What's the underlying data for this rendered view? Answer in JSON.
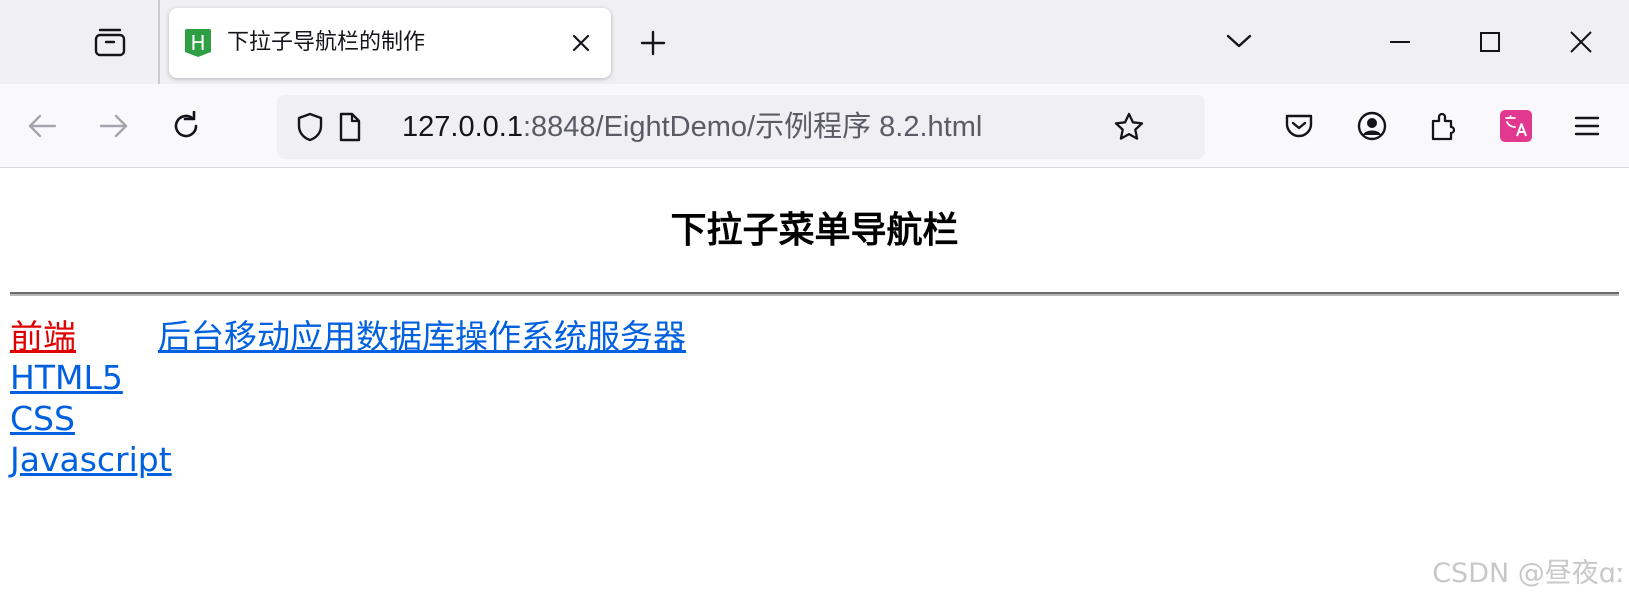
{
  "browser": {
    "tab": {
      "favicon_letter": "H",
      "title": "下拉子导航栏的制作"
    },
    "url": {
      "host": "127.0.0.1",
      "rest": ":8848/EightDemo/示例程序 8.2.html"
    },
    "icons": {
      "tab_overview": "tab-overview-icon",
      "close_tab": "close-icon",
      "new_tab": "plus-icon",
      "list_all_tabs": "chevron-down-icon",
      "minimize": "minimize-icon",
      "maximize": "maximize-icon",
      "close_window": "close-icon",
      "back": "back-arrow-icon",
      "forward": "forward-arrow-icon",
      "reload": "reload-icon",
      "tracking_protection": "shield-icon",
      "page_info": "page-icon",
      "bookmark": "star-icon",
      "pocket": "pocket-icon",
      "account": "account-icon",
      "extensions": "puzzle-icon",
      "translate": "translate-icon",
      "menu": "hamburger-menu-icon"
    },
    "colors": {
      "tabstrip_bg": "#f0f0f4",
      "toolbar_bg": "#f9f9fb",
      "favicon_green": "#2ea043",
      "translate_pink": "#e2388f"
    }
  },
  "page": {
    "heading": "下拉子菜单导航栏",
    "menu": {
      "frontend": {
        "label": "前端",
        "subitems": [
          "HTML5",
          "CSS",
          "Javascript"
        ]
      },
      "others": [
        "后台",
        "移动应用",
        "数据库",
        "操作系统",
        "服务器"
      ]
    },
    "colors": {
      "link": "#0060df",
      "active_link": "#e00000"
    }
  },
  "watermark": "CSDN @昼夜ɑː"
}
